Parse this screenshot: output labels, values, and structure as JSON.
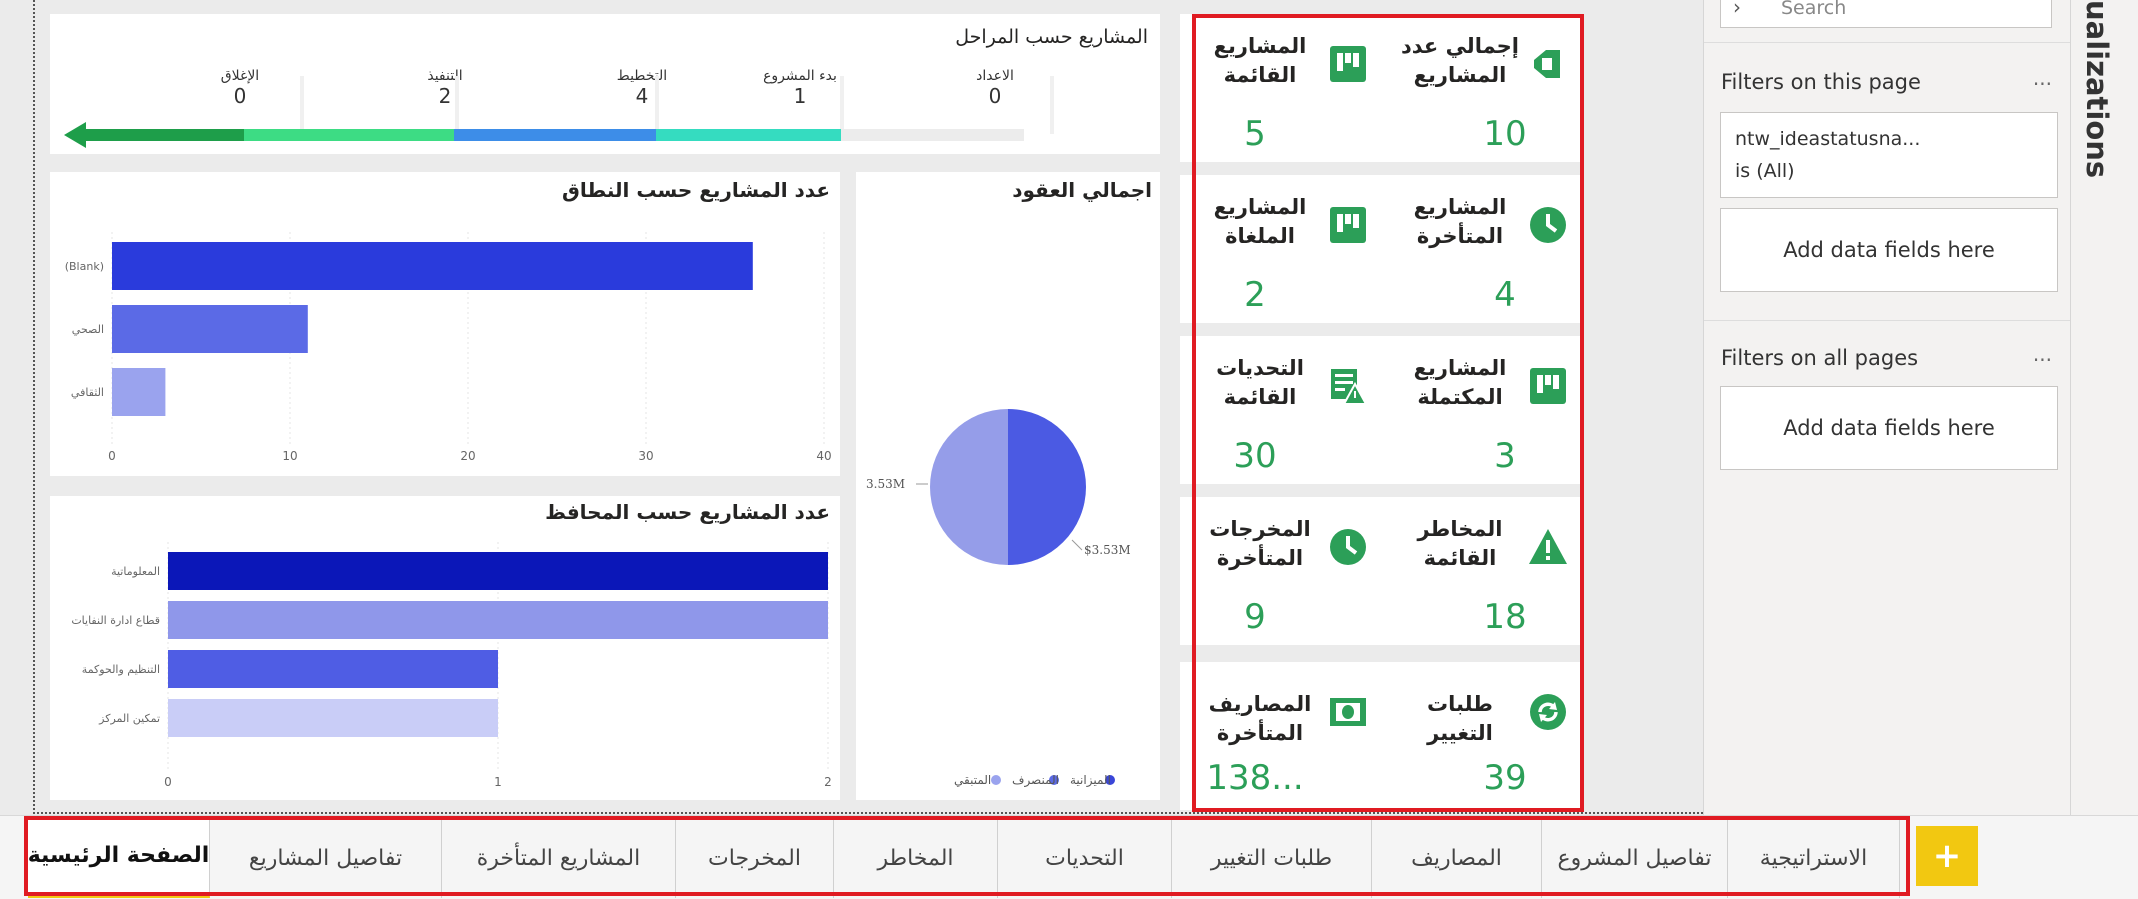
{
  "phases": {
    "title": "المشاريع حسب المراحل",
    "items": [
      {
        "name": "الإغلاق",
        "value": "0"
      },
      {
        "name": "التنفيذ",
        "value": "2"
      },
      {
        "name": "التخطيط",
        "value": "4"
      },
      {
        "name": "بدء المشروع",
        "value": "1"
      },
      {
        "name": "الاعداد",
        "value": "0"
      }
    ]
  },
  "scope_chart": {
    "title": "عدد المشاريع حسب النطاق",
    "categories": [
      "(Blank)",
      "الصحي",
      "الثقافي"
    ],
    "values": [
      36,
      11,
      3
    ],
    "ticks": [
      "0",
      "10",
      "20",
      "30",
      "40"
    ],
    "xlim": [
      0,
      40
    ],
    "colors": [
      "#2a3bdc",
      "#5b6ae6",
      "#9aa3ee"
    ]
  },
  "gov_chart": {
    "title": "عدد المشاريع حسب المحافظ",
    "categories": [
      "المعلوماتية",
      "قطاع ادارة النفايات",
      "التنظيم والحوكمة",
      "تمكين المركز"
    ],
    "values": [
      2,
      2,
      1,
      1
    ],
    "ticks": [
      "0",
      "1",
      "2"
    ],
    "xlim": [
      0,
      2
    ],
    "colors": [
      "#0b17b8",
      "#8f97ea",
      "#4f5de4",
      "#c9cdf7"
    ]
  },
  "contracts_chart": {
    "title": "اجمالي العقود",
    "left_label": "3.53M",
    "right_label": "$3.53M",
    "legend": [
      {
        "name": "الميزانية",
        "color": "#3a46d8"
      },
      {
        "name": "المنصرف",
        "color": "#5b6ae6"
      },
      {
        "name": "المتبقي",
        "color": "#9aa3ee"
      }
    ]
  },
  "chart_data": [
    {
      "type": "bar",
      "title": "عدد المشاريع حسب النطاق",
      "categories": [
        "(Blank)",
        "الصحي",
        "الثقافي"
      ],
      "values": [
        36,
        11,
        3
      ],
      "xlim": [
        0,
        40
      ]
    },
    {
      "type": "bar",
      "title": "عدد المشاريع حسب المحافظ",
      "categories": [
        "المعلوماتية",
        "قطاع ادارة النفايات",
        "التنظيم والحوكمة",
        "تمكين المركز"
      ],
      "values": [
        2,
        2,
        1,
        1
      ],
      "xlim": [
        0,
        2
      ]
    },
    {
      "type": "pie",
      "title": "اجمالي العقود",
      "labels": [
        "المتبقي",
        "المنصرف"
      ],
      "values": [
        3.53,
        3.53
      ],
      "legend": [
        "الميزانية",
        "المنصرف",
        "المتبقي"
      ]
    }
  ],
  "kpis": {
    "total": {
      "label1": "إجمالي عدد",
      "label2": "المشاريع",
      "value": "10"
    },
    "existing": {
      "label1": "المشاريع",
      "label2": "القائمة",
      "value": "5"
    },
    "delayed": {
      "label1": "المشاريع",
      "label2": "المتأخرة",
      "value": "4"
    },
    "cancelled": {
      "label1": "المشاريع",
      "label2": "الملغاة",
      "value": "2"
    },
    "completed": {
      "label1": "المشاريع",
      "label2": "المكتملة",
      "value": "3"
    },
    "challenges": {
      "label1": "التحديات",
      "label2": "القائمة",
      "value": "30"
    },
    "risks": {
      "label1": "المخاطر",
      "label2": "القائمة",
      "value": "18"
    },
    "late_outputs": {
      "label1": "المخرجات",
      "label2": "المتأخرة",
      "value": "9"
    },
    "change_requests": {
      "label1": "طلبات",
      "label2": "التغيير",
      "value": "39"
    },
    "late_expenses": {
      "label1": "المصاريف",
      "label2": "المتأخرة",
      "value": "138..."
    }
  },
  "tabs": [
    {
      "label": "الصفحة الرئيسية",
      "active": true
    },
    {
      "label": "تفاصيل المشاريع"
    },
    {
      "label": "المشاريع المتأخرة"
    },
    {
      "label": "المخرجات"
    },
    {
      "label": "المخاطر"
    },
    {
      "label": "التحديات"
    },
    {
      "label": "طلبات التغيير"
    },
    {
      "label": "المصاريف"
    },
    {
      "label": "تفاصيل المشروع"
    },
    {
      "label": "الاستراتيجية"
    }
  ],
  "add_tab_label": "+",
  "filters": {
    "search_placeholder": "Search",
    "page_header": "Filters on this page",
    "page_more": "...",
    "filter_field": "ntw_ideastatusna...",
    "filter_value": "is (All)",
    "add_fields": "Add data fields here",
    "all_header": "Filters on all pages",
    "all_more": "...",
    "add_fields_all": "Add data fields here"
  },
  "viz_pane_label": "ualizations"
}
